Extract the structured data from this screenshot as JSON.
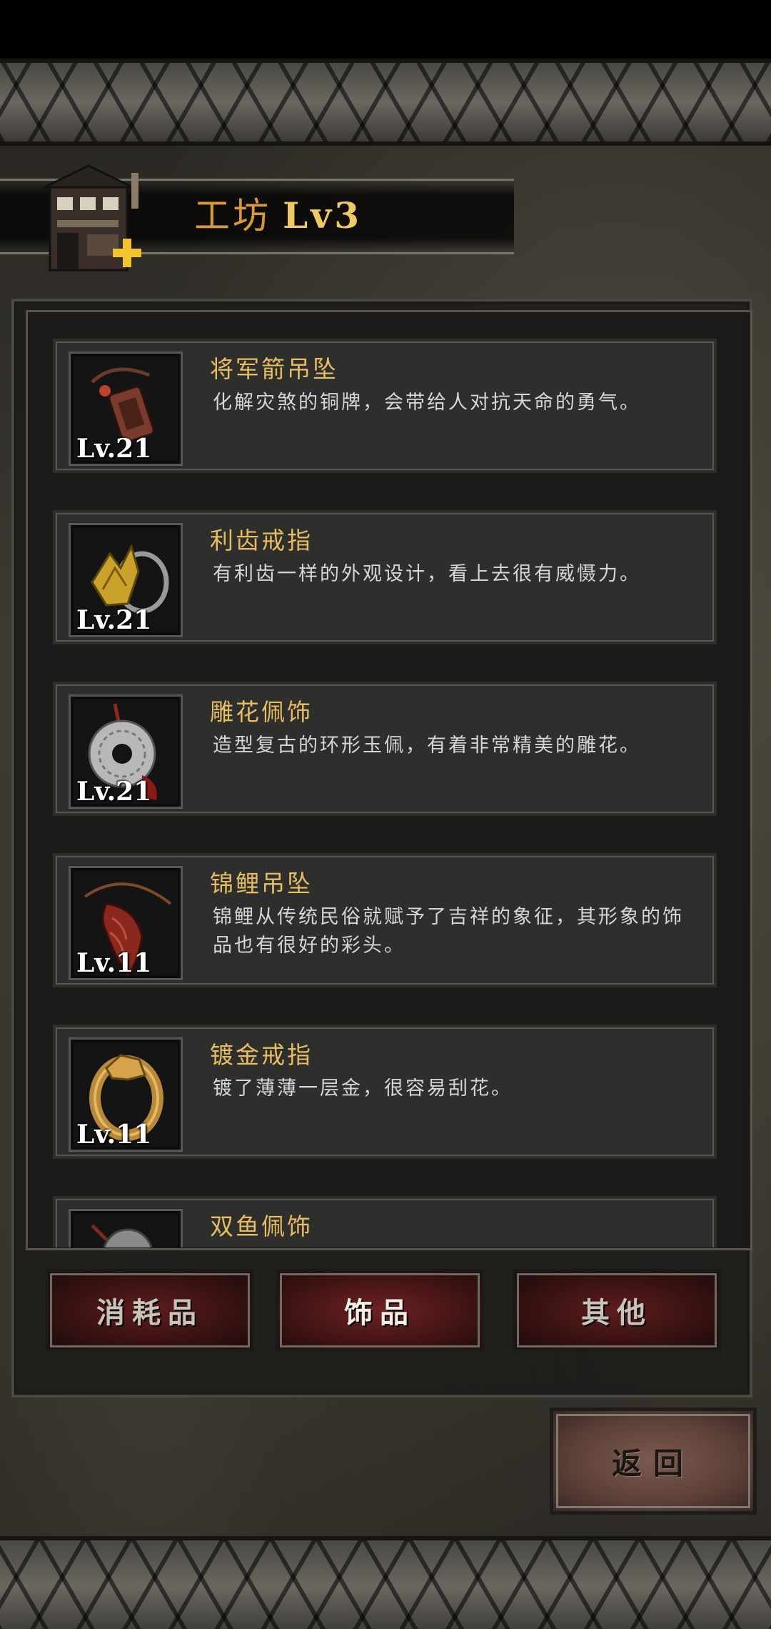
{
  "header": {
    "title": "工坊",
    "level": "Lv3"
  },
  "items": [
    {
      "name": "将军箭吊坠",
      "desc": "化解灾煞的铜牌，会带给人对抗天命的勇气。",
      "level": "Lv.21",
      "icon": "talisman-pendant-icon"
    },
    {
      "name": "利齿戒指",
      "desc": "有利齿一样的外观设计，看上去很有威慑力。",
      "level": "Lv.21",
      "icon": "fang-ring-icon"
    },
    {
      "name": "雕花佩饰",
      "desc": "造型复古的环形玉佩，有着非常精美的雕花。",
      "level": "Lv.21",
      "icon": "jade-disc-icon"
    },
    {
      "name": "锦鲤吊坠",
      "desc": "锦鲤从传统民俗就赋予了吉祥的象征，其形象的饰品也有很好的彩头。",
      "level": "Lv.11",
      "icon": "koi-pendant-icon"
    },
    {
      "name": "镀金戒指",
      "desc": "镀了薄薄一层金，很容易刮花。",
      "level": "Lv.11",
      "icon": "gold-ring-icon"
    },
    {
      "name": "双鱼佩饰",
      "desc": "",
      "level": "",
      "icon": "twin-fish-pendant-icon"
    }
  ],
  "tabs": [
    {
      "label": "消耗品",
      "active": false
    },
    {
      "label": "饰品",
      "active": true
    },
    {
      "label": "其他",
      "active": false
    }
  ],
  "back_label": "返回",
  "colors": {
    "title": "#d99a3a",
    "item_name": "#e6bd60",
    "tab_bg": "#5e1d1d",
    "back_bg": "#7a5a50"
  }
}
